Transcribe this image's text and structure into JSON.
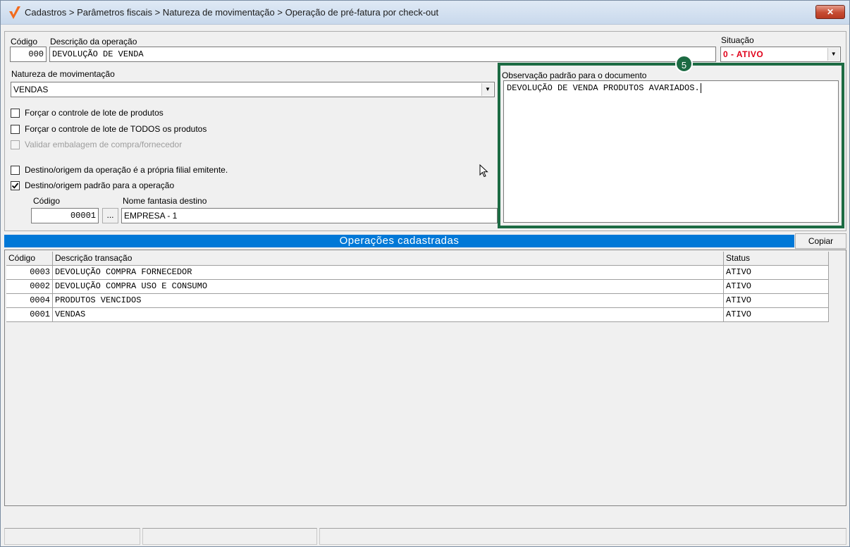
{
  "window": {
    "title": "Cadastros > Parâmetros fiscais > Natureza de movimentação > Operação de pré-fatura por check-out",
    "close_label": "✕"
  },
  "form": {
    "codigo_label": "Código",
    "codigo_value": "000",
    "descricao_label": "Descrição da operação",
    "descricao_value": "DEVOLUÇÃO DE VENDA",
    "situacao_label": "Situação",
    "situacao_value": "0 - ATIVO",
    "natureza_label": "Natureza de movimentação",
    "natureza_value": "VENDAS",
    "observacao_label": "Observação padrão para o documento",
    "observacao_value": "DEVOLUÇÃO DE VENDA PRODUTOS AVARIADOS.",
    "checkboxes": [
      {
        "label": "Forçar o controle de lote de produtos",
        "checked": false,
        "disabled": false
      },
      {
        "label": "Forçar o controle de lote de TODOS os produtos",
        "checked": false,
        "disabled": false
      },
      {
        "label": "Validar embalagem de compra/fornecedor",
        "checked": false,
        "disabled": true
      },
      {
        "label": "Destino/origem da operação é a própria filial emitente.",
        "checked": false,
        "disabled": false
      },
      {
        "label": "Destino/origem padrão para a operação",
        "checked": true,
        "disabled": false
      }
    ],
    "destino_codigo_label": "Código",
    "destino_codigo_value": "00001",
    "browse_label": "...",
    "destino_nome_label": "Nome fantasia destino",
    "destino_nome_value": "EMPRESA - 1"
  },
  "annotation": {
    "step": "5",
    "color": "#1c6b43"
  },
  "section": {
    "title": "Operações cadastradas",
    "copiar_label": "Copiar",
    "color": "#0078d7"
  },
  "grid": {
    "headers": [
      "Código",
      "Descrição  transação",
      "Status"
    ],
    "rows": [
      [
        "0003",
        "DEVOLUÇÃO COMPRA FORNECEDOR",
        "ATIVO"
      ],
      [
        "0002",
        "DEVOLUÇÃO COMPRA USO E CONSUMO",
        "ATIVO"
      ],
      [
        "0004",
        "PRODUTOS VENCIDOS",
        "ATIVO"
      ],
      [
        "0001",
        "VENDAS",
        "ATIVO"
      ]
    ]
  }
}
